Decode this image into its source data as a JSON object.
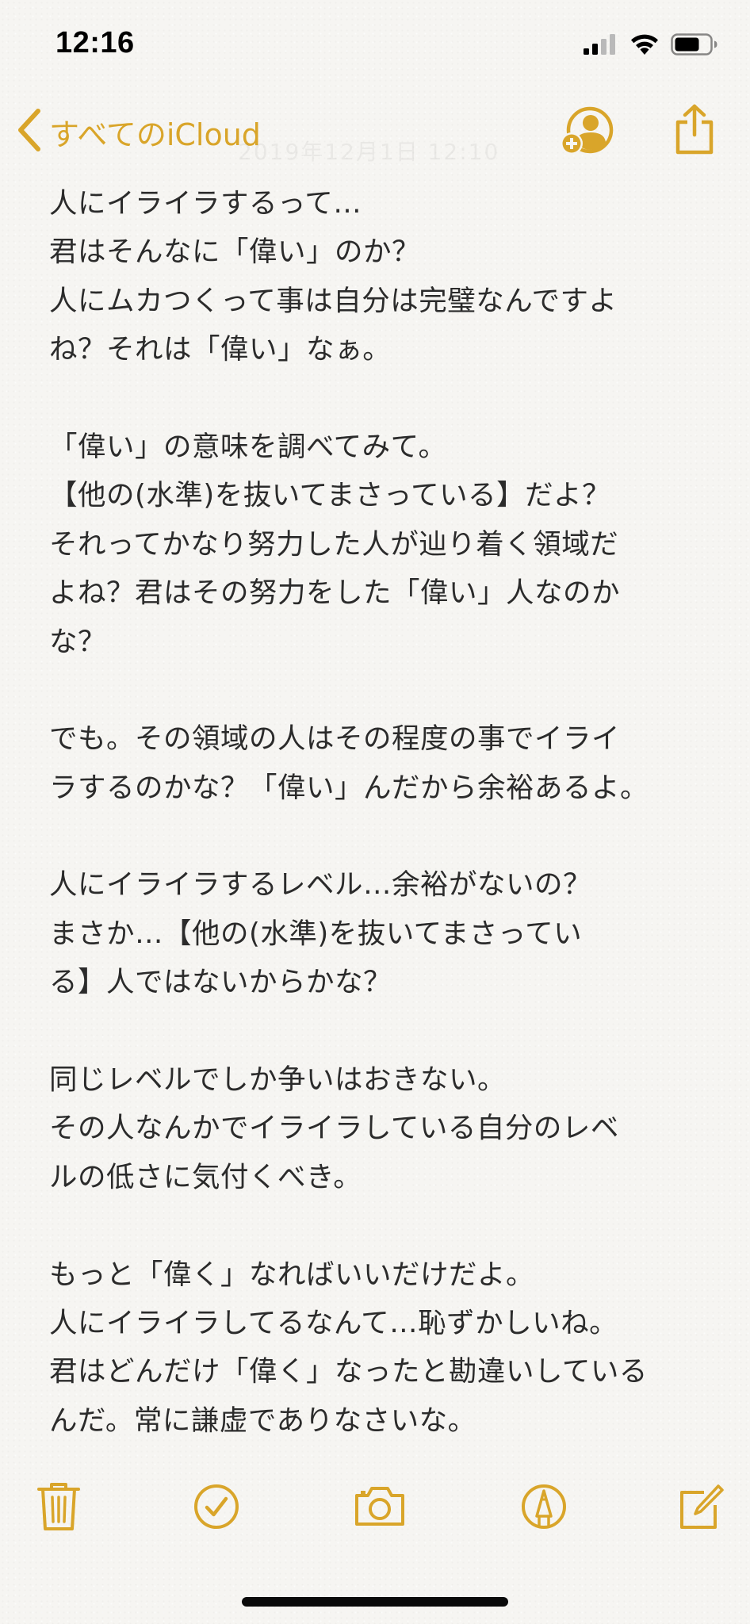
{
  "status_bar": {
    "time": "12:16"
  },
  "nav": {
    "back_label": "すべてのiCloud",
    "faint_date": "2019年12月1日 12:10"
  },
  "note": {
    "lines": [
      "人にイライラするって…",
      "君はそんなに「偉い」のか？",
      "人にムカつくって事は自分は完璧なんですよ",
      "ね？それは「偉い」なぁ。",
      "",
      "「偉い」の意味を調べてみて。",
      "【他の(水準)を抜いてまさっている】だよ？",
      "それってかなり努力した人が辿り着く領域だ",
      "よね？君はその努力をした「偉い」人なのか",
      "な？",
      "",
      "でも。その領域の人はその程度の事でイライ",
      "ラするのかな？「偉い」んだから余裕あるよ。",
      "",
      "人にイライラするレベル…余裕がないの？",
      "まさか…【他の(水準)を抜いてまさってい",
      "る】人ではないからかな？",
      "",
      "同じレベルでしか争いはおきない。",
      "その人なんかでイライラしている自分のレベ",
      "ルの低さに気付くべき。",
      "",
      "もっと「偉く」なればいいだけだよ。",
      "人にイライラしてるなんて…恥ずかしいね。",
      "君はどんだけ「偉く」なったと勘違いしている",
      "んだ。常に謙虚でありなさいな。"
    ]
  },
  "colors": {
    "accent": "#d9a52a",
    "text": "#2b2b2b",
    "background": "#f6f5f2"
  },
  "icons": {
    "back": "chevron-left-icon",
    "add_person": "add-person-icon",
    "share": "share-icon",
    "trash": "trash-icon",
    "checklist": "checklist-icon",
    "camera": "camera-icon",
    "markup": "markup-icon",
    "compose": "compose-icon"
  }
}
